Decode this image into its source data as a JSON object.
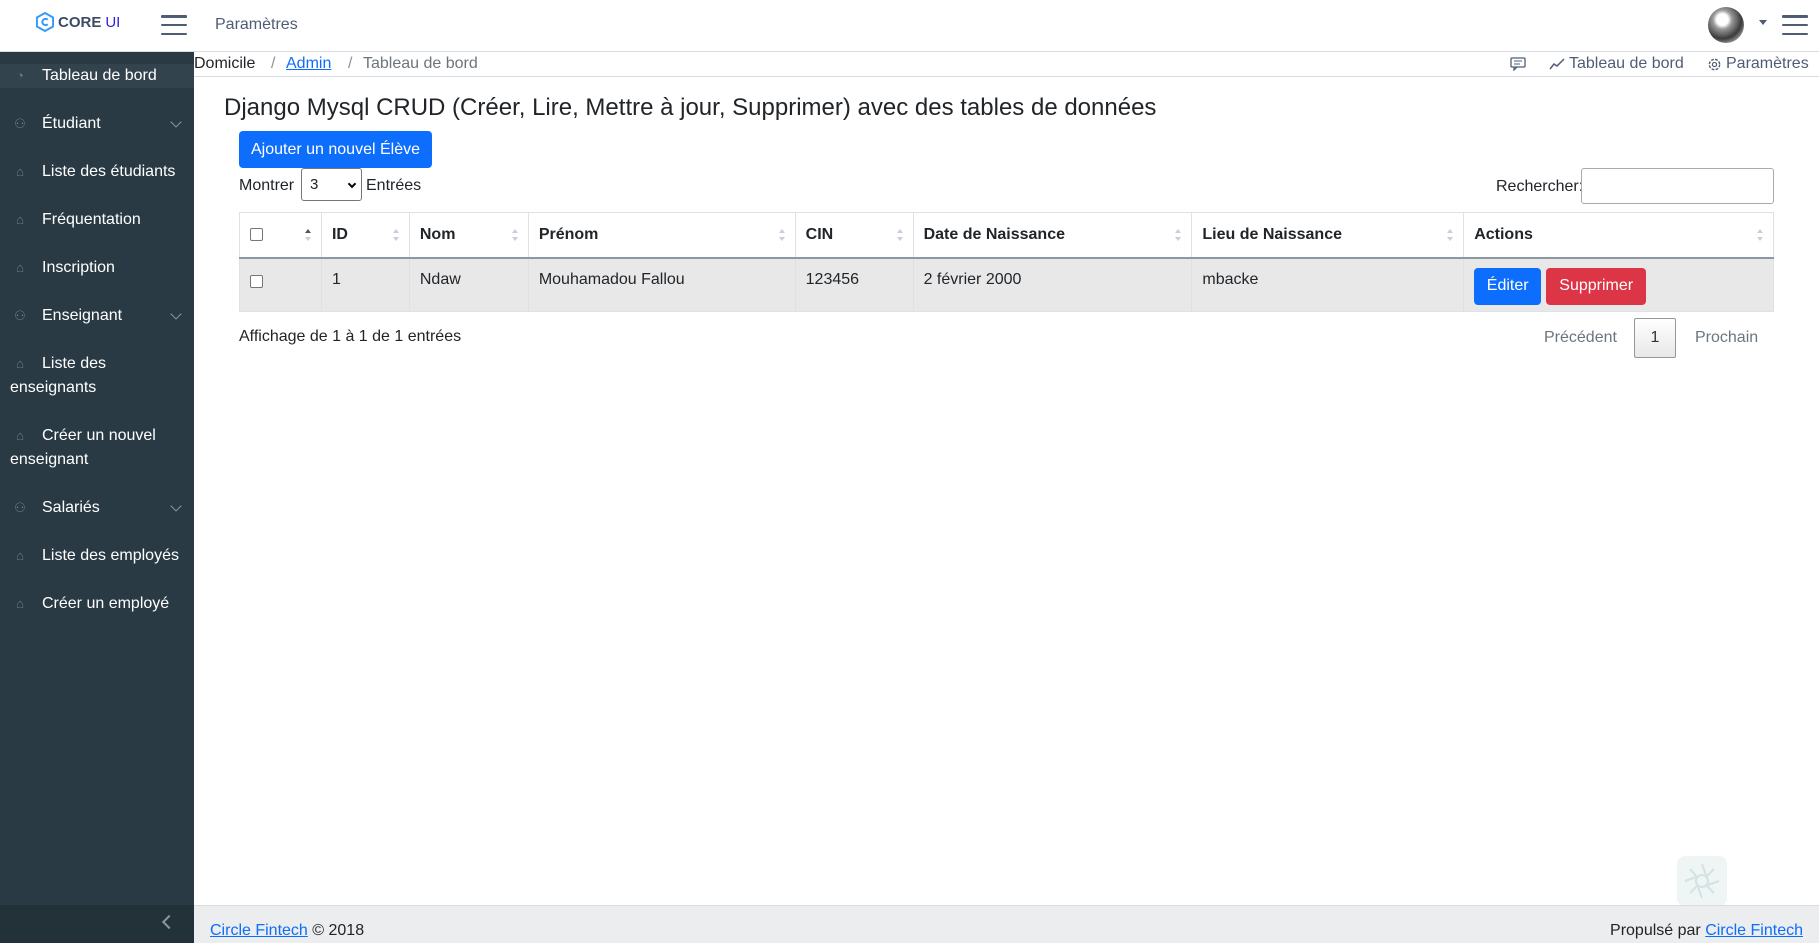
{
  "header": {
    "brand_core": "CORE",
    "brand_ui": "UI",
    "nav_item": "Paramètres"
  },
  "sidebar": {
    "items": [
      {
        "label": "Tableau de bord",
        "icon": "speedometer-icon",
        "has_children": false
      },
      {
        "label": "Étudiant",
        "icon": "user-icon",
        "has_children": true
      },
      {
        "label": "Liste des étudiants",
        "icon": "tags-icon",
        "has_children": false
      },
      {
        "label": "Fréquentation",
        "icon": "tags-icon",
        "has_children": false
      },
      {
        "label": "Inscription",
        "icon": "tags-icon",
        "has_children": false
      },
      {
        "label": "Enseignant",
        "icon": "user-icon",
        "has_children": true
      },
      {
        "label": "Liste des enseignants",
        "icon": "tags-icon",
        "has_children": false
      },
      {
        "label": "Créer un nouvel enseignant",
        "icon": "tags-icon",
        "has_children": false
      },
      {
        "label": "Salariés",
        "icon": "user-icon",
        "has_children": true
      },
      {
        "label": "Liste des employés",
        "icon": "tags-icon",
        "has_children": false
      },
      {
        "label": "Créer un employé",
        "icon": "tags-icon",
        "has_children": false
      }
    ]
  },
  "breadcrumb": {
    "home": "Domicile",
    "admin": "Admin",
    "current": "Tableau de bord",
    "sep": "/"
  },
  "subheader_right": {
    "dashboard": "Tableau de bord",
    "settings": "Paramètres"
  },
  "main": {
    "title": "Django Mysql CRUD (Créer, Lire, Mettre à jour, Supprimer) avec des tables de données",
    "add_button": "Ajouter un nouvel Élève",
    "show_label": "Montrer",
    "entries_label": "Entrées",
    "page_length": "3",
    "search_label": "Rechercher:",
    "search_value": ""
  },
  "table": {
    "columns": [
      "ID",
      "Nom",
      "Prénom",
      "CIN",
      "Date de Naissance",
      "Lieu de Naissance",
      "Actions"
    ],
    "rows": [
      {
        "id": "1",
        "nom": "Ndaw",
        "prenom": "Mouhamadou Fallou",
        "cin": "123456",
        "date": "2 février 2000",
        "lieu": "mbacke",
        "edit": "Éditer",
        "delete": "Supprimer"
      }
    ]
  },
  "pagination": {
    "info": "Affichage de 1 à 1 de 1 entrées",
    "previous": "Précédent",
    "current": "1",
    "next": "Prochain"
  },
  "footer": {
    "left_link": "Circle Fintech",
    "left_text": "© 2018",
    "right_text": "Propulsé par",
    "right_link": "Circle Fintech"
  },
  "colors": {
    "sidebar_bg": "#2a3a44",
    "primary": "#0d6efd",
    "danger": "#dc3545",
    "brand": "#321fdb"
  }
}
